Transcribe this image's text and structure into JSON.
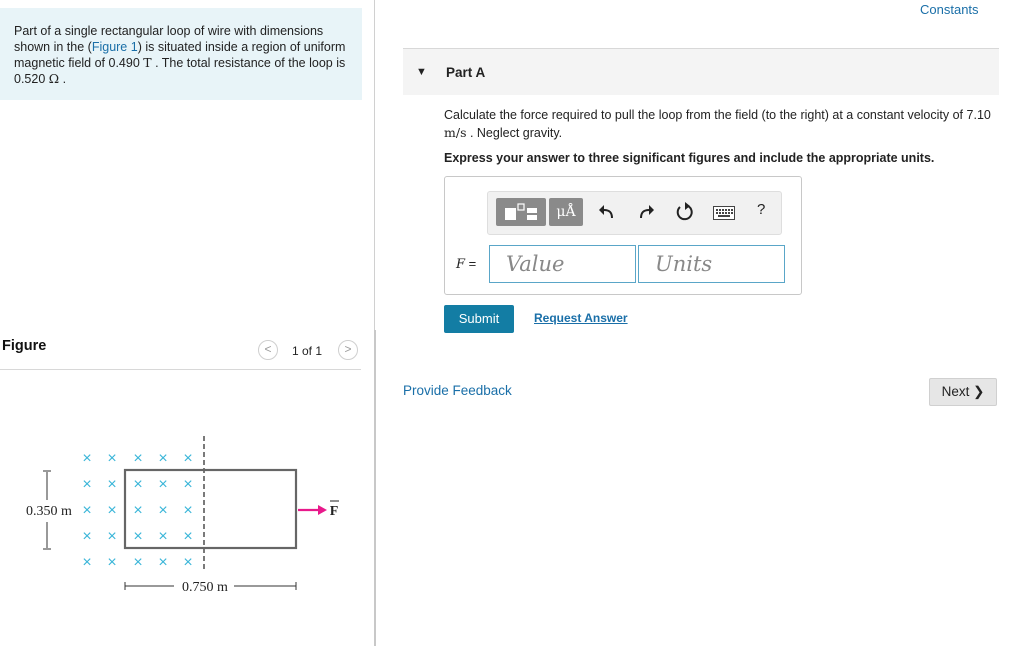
{
  "problem": {
    "part1": "Part of a single rectangular loop of wire with dimensions shown in the (",
    "figure_link": "Figure 1",
    "part2": ") is situated inside a region of uniform magnetic field of 0.490 ",
    "field_unit": "T",
    "part3": " . The total resistance of the loop is 0.520 ",
    "resistance_unit": "Ω",
    "part4": " ."
  },
  "figure": {
    "title": "Figure",
    "pager": "1 of 1",
    "prev_icon": "<",
    "next_icon": ">",
    "height_label": "0.350 m",
    "width_label": "0.750 m",
    "force_label": "F",
    "field_symbol": "×"
  },
  "constants_link": "Constants",
  "part": {
    "caret": "▼",
    "title": "Part A",
    "question_text": "Calculate the force required to pull the loop from the field (to the right) at a constant velocity of ",
    "velocity_value": "7.10 ",
    "velocity_unit": "m/s",
    "question_tail": " . Neglect gravity.",
    "instruction": "Express your answer to three significant figures and include the appropriate units."
  },
  "toolbar": {
    "units_symbol": "μÅ",
    "help_label": "?",
    "icons": [
      "templates-icon",
      "units-icon",
      "undo-icon",
      "redo-icon",
      "reset-icon",
      "keyboard-icon",
      "help-icon"
    ]
  },
  "answer": {
    "variable": "F",
    "equals": "=",
    "value_placeholder": "Value",
    "units_placeholder": "Units"
  },
  "buttons": {
    "submit": "Submit",
    "request_answer": "Request Answer",
    "feedback": "Provide Feedback",
    "next": "Next"
  },
  "colors": {
    "accent_blue": "#137da4",
    "link_blue": "#1a6fa8",
    "problem_bg": "#e8f4f8",
    "field_cross": "#39b5d8",
    "force_arrow": "#e8198b"
  }
}
